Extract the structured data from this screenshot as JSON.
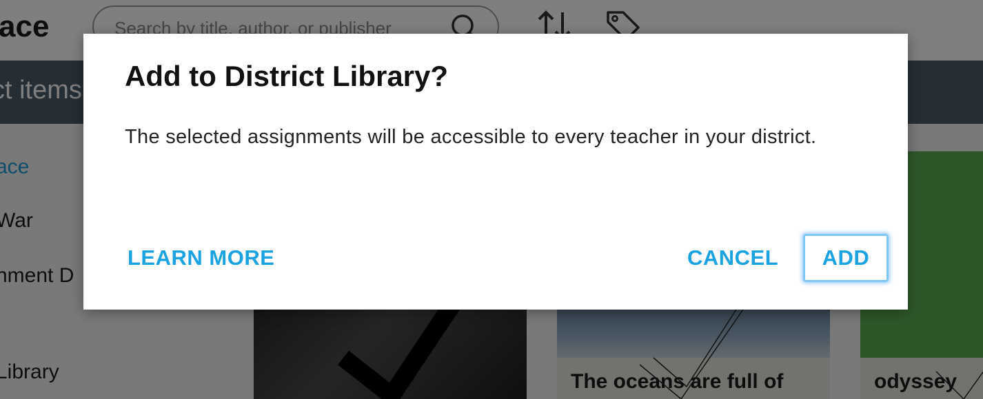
{
  "app": {
    "title": "ace"
  },
  "search": {
    "placeholder": "Search by title, author, or publisher"
  },
  "selection_bar": {
    "text": "ct items"
  },
  "sidebar": {
    "items": [
      {
        "label": "ace",
        "active": true
      },
      {
        "label": "War",
        "active": false
      },
      {
        "label": "nment D",
        "active": false
      },
      {
        "label": "Library",
        "active": false
      }
    ]
  },
  "cards": [
    {
      "title": ""
    },
    {
      "title": "The oceans are full of"
    },
    {
      "title": "odyssey"
    }
  ],
  "dialog": {
    "title": "Add to District Library?",
    "body": "The selected assignments will be accessible to every teacher in your district.",
    "learn_more_label": "LEARN MORE",
    "cancel_label": "CANCEL",
    "add_label": "ADD"
  },
  "colors": {
    "accent": "#1aa3e0",
    "selection_bar": "#4b5c6b",
    "overlay": "rgba(0,0,0,0.5)"
  }
}
